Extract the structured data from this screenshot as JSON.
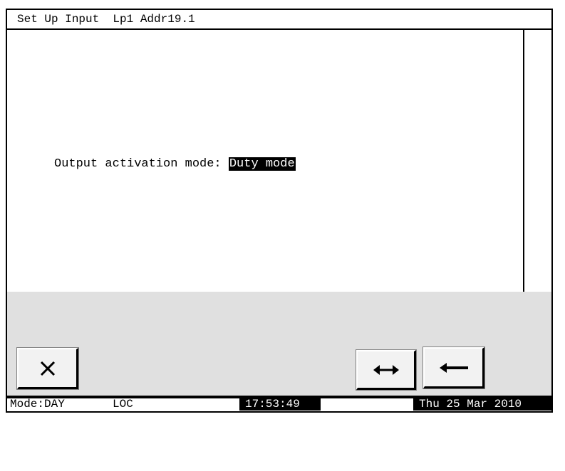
{
  "window": {
    "title": "Set Up Input  Lp1 Addr19.1"
  },
  "main": {
    "field_label": "Output activation mode: ",
    "field_value": "Duty mode"
  },
  "buttons": {
    "cancel": {
      "icon": "close-icon"
    },
    "toggle": {
      "icon": "left-right-arrow-icon"
    },
    "back": {
      "icon": "back-arrow-icon"
    }
  },
  "status": {
    "mode": "Mode:DAY",
    "loc": "LOC",
    "time": "17:53:49",
    "date": "Thu 25 Mar 2010"
  },
  "colors": {
    "button_area_bg": "#e0e0e0",
    "highlight_bg": "#000000",
    "highlight_fg": "#ffffff"
  }
}
